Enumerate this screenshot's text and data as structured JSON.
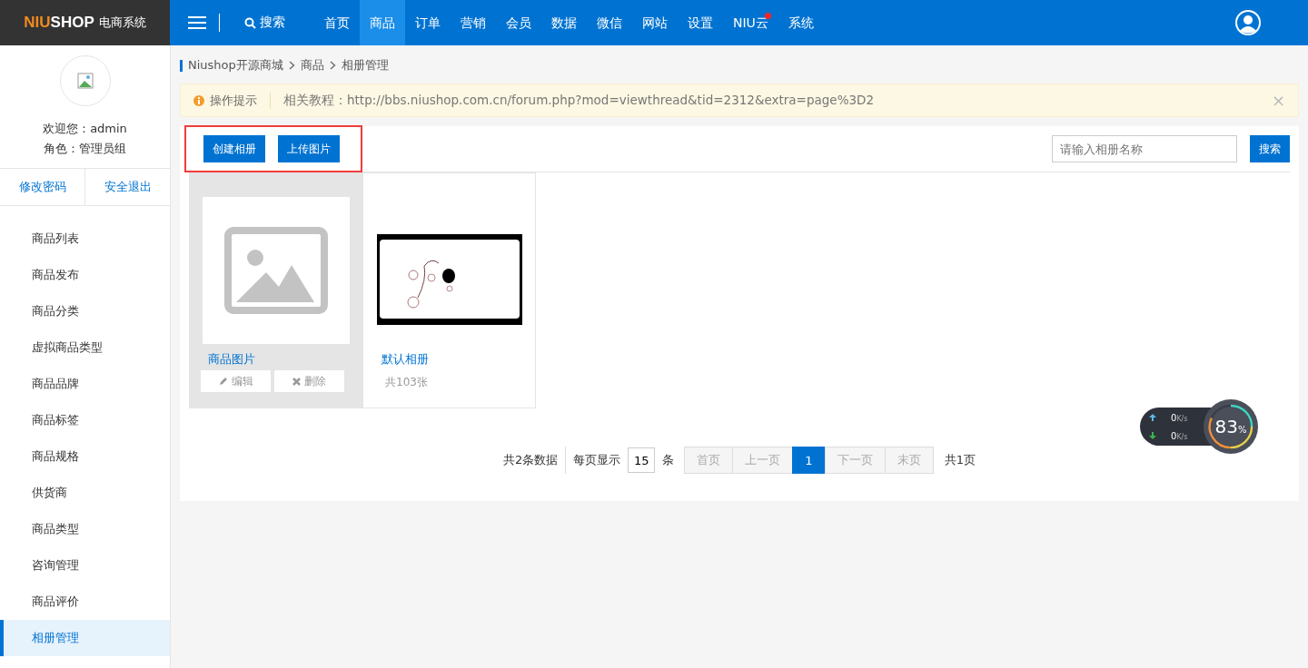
{
  "logo": {
    "brand_accent": "NIU",
    "brand_rest": "SHOP",
    "subtitle": "电商系统"
  },
  "topbar": {
    "search_label": "搜索",
    "nav": [
      {
        "label": "首页",
        "selected": false,
        "dot": false
      },
      {
        "label": "商品",
        "selected": true,
        "dot": false
      },
      {
        "label": "订单",
        "selected": false,
        "dot": false
      },
      {
        "label": "营销",
        "selected": false,
        "dot": false
      },
      {
        "label": "会员",
        "selected": false,
        "dot": false
      },
      {
        "label": "数据",
        "selected": false,
        "dot": false
      },
      {
        "label": "微信",
        "selected": false,
        "dot": false
      },
      {
        "label": "网站",
        "selected": false,
        "dot": false
      },
      {
        "label": "设置",
        "selected": false,
        "dot": false
      },
      {
        "label": "NIU云",
        "selected": false,
        "dot": true
      },
      {
        "label": "系统",
        "selected": false,
        "dot": false
      }
    ]
  },
  "sidebar": {
    "welcome": "欢迎您：admin",
    "role": "角色：管理员组",
    "links": [
      "修改密码",
      "安全退出"
    ],
    "items": [
      {
        "label": "商品列表",
        "selected": false
      },
      {
        "label": "商品发布",
        "selected": false
      },
      {
        "label": "商品分类",
        "selected": false
      },
      {
        "label": "虚拟商品类型",
        "selected": false
      },
      {
        "label": "商品品牌",
        "selected": false
      },
      {
        "label": "商品标签",
        "selected": false
      },
      {
        "label": "商品规格",
        "selected": false
      },
      {
        "label": "供货商",
        "selected": false
      },
      {
        "label": "商品类型",
        "selected": false
      },
      {
        "label": "咨询管理",
        "selected": false
      },
      {
        "label": "商品评价",
        "selected": false
      },
      {
        "label": "相册管理",
        "selected": true
      }
    ]
  },
  "breadcrumb": [
    "Niushop开源商城",
    "商品",
    "相册管理"
  ],
  "notice": {
    "label": "操作提示",
    "text": "相关教程：http://bbs.niushop.com.cn/forum.php?mod=viewthread&tid=2312&extra=page%3D2",
    "close": "×"
  },
  "toolbar": {
    "highlighted": true,
    "buttons": [
      "创建相册",
      "上传图片"
    ],
    "search": {
      "placeholder": "请输入相册名称",
      "button": "搜索"
    }
  },
  "albums": [
    {
      "name": "商品图片",
      "kind": "placeholder",
      "hovered": true,
      "actions": [
        "编辑",
        "删除"
      ]
    },
    {
      "name": "默认相册",
      "kind": "picture",
      "hovered": false,
      "count": "共103张"
    }
  ],
  "pagination": {
    "total": "共2条数据",
    "per_page_label": "每页显示",
    "per_page": "15",
    "unit": "条",
    "pages": [
      {
        "label": "首页",
        "selected": false,
        "disabled": true
      },
      {
        "label": "上一页",
        "selected": false,
        "disabled": true
      },
      {
        "label": "1",
        "selected": true,
        "disabled": false
      },
      {
        "label": "下一页",
        "selected": false,
        "disabled": true
      },
      {
        "label": "末页",
        "selected": false,
        "disabled": true
      }
    ],
    "page_count": "共1页"
  },
  "speed_widget": {
    "upload": "0",
    "download": "0",
    "upload_unit": "K/s",
    "download_unit": "K/s",
    "percent": "83",
    "percent_sign": "%"
  }
}
